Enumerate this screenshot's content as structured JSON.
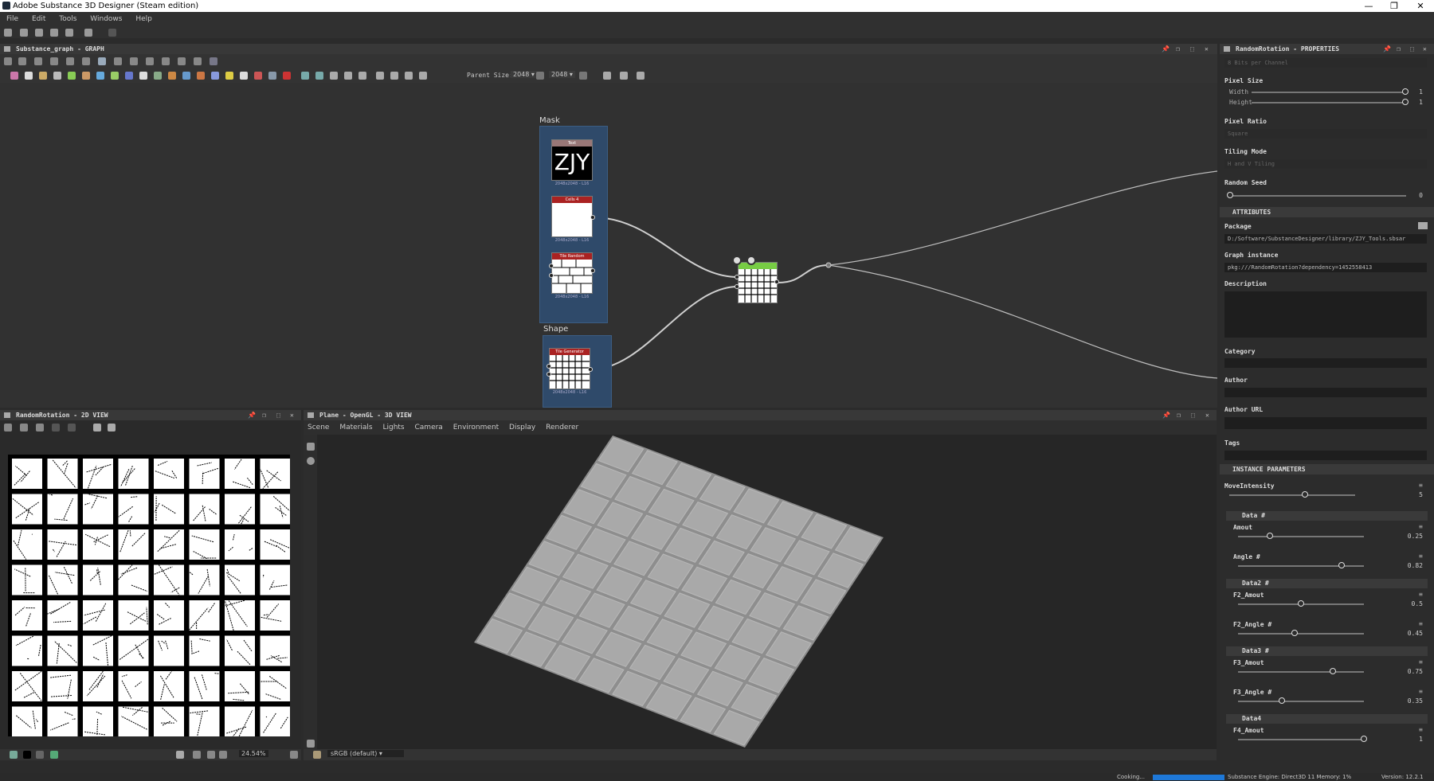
{
  "window": {
    "title": "Adobe Substance 3D Designer (Steam edition)",
    "controls": [
      "—",
      "❐",
      "✕"
    ]
  },
  "menu": [
    "File",
    "Edit",
    "Tools",
    "Windows",
    "Help"
  ],
  "graph": {
    "title": "Substance_graph - GRAPH",
    "parent_size_label": "Parent Size:",
    "parent_size": "2048",
    "size2": "2048",
    "frames": [
      {
        "label": "Mask"
      },
      {
        "label": "Shape"
      }
    ],
    "nodes": [
      {
        "head": "Text",
        "big": "ZJY",
        "caption": "2048x2048 - L16"
      },
      {
        "head": "Cells 4",
        "caption": "2048x2048 - L16"
      },
      {
        "head": "Tile Random",
        "caption": "2048x2048 - L16"
      },
      {
        "head": "Tile Generator",
        "caption": "2048x2048 - L16"
      }
    ]
  },
  "view2d": {
    "title": "RandomRotation - 2D VIEW",
    "zoom": "24.54%"
  },
  "view3d": {
    "title": "Plane - OpenGL - 3D VIEW",
    "tabs": [
      "Scene",
      "Materials",
      "Lights",
      "Camera",
      "Environment",
      "Display",
      "Renderer"
    ],
    "colorspace": "sRGB (default)"
  },
  "props": {
    "title": "RandomRotation - PROPERTIES",
    "bits": "8 Bits per Channel",
    "pixel_size": {
      "label": "Pixel Size",
      "width_label": "Width",
      "height_label": "Height",
      "width": "1",
      "height": "1"
    },
    "pixel_ratio": {
      "label": "Pixel Ratio",
      "value": "Square"
    },
    "tiling": {
      "label": "Tiling Mode",
      "value": "H and V Tiling"
    },
    "seed": {
      "label": "Random Seed",
      "value": "0"
    },
    "attributes": {
      "label": "ATTRIBUTES",
      "package_label": "Package",
      "package": "D:/Software/SubstanceDesigner/library/ZJY_Tools.sbsar",
      "instance_label": "Graph instance",
      "instance": "pkg:///RandomRotation?dependency=1452558413",
      "description_label": "Description",
      "category_label": "Category",
      "author_label": "Author",
      "author_url_label": "Author URL",
      "tags_label": "Tags"
    },
    "instance": {
      "label": "INSTANCE PARAMETERS",
      "move": {
        "label": "MoveIntensity",
        "value": "5",
        "frac": 0.6
      },
      "groups": [
        {
          "label": "Data #",
          "params": [
            {
              "label": "Amout",
              "value": "0.25",
              "frac": 0.25
            },
            {
              "label": "Angle #",
              "value": "0.82",
              "frac": 0.82
            }
          ]
        },
        {
          "label": "Data2 #",
          "params": [
            {
              "label": "F2_Amout",
              "value": "0.5",
              "frac": 0.5
            },
            {
              "label": "F2_Angle #",
              "value": "0.45",
              "frac": 0.45
            }
          ]
        },
        {
          "label": "Data3 #",
          "params": [
            {
              "label": "F3_Amout",
              "value": "0.75",
              "frac": 0.75
            },
            {
              "label": "F3_Angle #",
              "value": "0.35",
              "frac": 0.35
            }
          ]
        },
        {
          "label": "Data4",
          "params": [
            {
              "label": "F4_Amout",
              "value": "1",
              "frac": 1.0
            }
          ]
        }
      ]
    }
  },
  "status": {
    "cooking": "Cooking...",
    "engine": "Substance Engine: Direct3D 11 Memory: 1%",
    "version": "Version: 12.2.1"
  }
}
